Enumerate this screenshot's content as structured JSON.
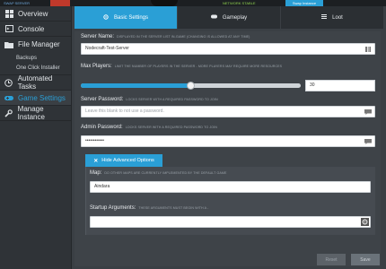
{
  "topbar": {
    "hint": "SWAP SERVER",
    "status": "NETWORK STABLE",
    "swap_button": "Swap Instance"
  },
  "sidebar": {
    "items": [
      {
        "label": "Overview",
        "icon": "dashboard-icon"
      },
      {
        "label": "Console",
        "icon": "console-icon"
      },
      {
        "label": "File Manager",
        "icon": "folder-icon"
      },
      {
        "label": "Automated Tasks",
        "icon": "clock-icon"
      },
      {
        "label": "Game Settings",
        "icon": "gamepad-icon"
      },
      {
        "label": "Manage Instance",
        "icon": "wrench-icon"
      }
    ],
    "sub_items": [
      "Backups",
      "One Click Installer"
    ]
  },
  "tabs": [
    {
      "label": "Basic Settings",
      "icon": "gear-icon"
    },
    {
      "label": "Gameplay",
      "icon": "gamepad-icon"
    },
    {
      "label": "Loot",
      "icon": "list-icon"
    }
  ],
  "fields": {
    "server_name": {
      "label": "Server Name:",
      "hint": "DISPLAYED IN THE SERVER LIST IN-GAME (CHANGING IS ALLOWED AT ANY TIME)",
      "value": "Nodecraft-Test-Server"
    },
    "max_players": {
      "label": "Max Players:",
      "hint": "LIMIT THE NUMBER OF PLAYERS IN THE SERVER - MORE PLAYERS MAY REQUIRE MORE RESOURCES",
      "value": "30",
      "slider_fraction": 0.5
    },
    "server_password": {
      "label": "Server Password:",
      "hint": "LOCKS SERVER WITH A REQUIRED PASSWORD TO JOIN",
      "placeholder": "Leave this blank to not use a password."
    },
    "admin_password": {
      "label": "Admin Password:",
      "hint": "LOCKS SERVER WITH A REQUIRED PASSWORD TO JOIN",
      "value": "••••••••••••"
    }
  },
  "advanced": {
    "toggle_label": "Hide Advanced Options",
    "map": {
      "label": "Map:",
      "hint": "DO OTHER MAPS ARE CURRENTLY IMPLEMENTED BY THE DEFAULT GAME",
      "value": "Aindara"
    },
    "startup_args": {
      "label": "Startup Arguments:",
      "hint": "THESE ARGUMENTS MUST BEGIN WITH A -",
      "value": ""
    }
  },
  "footer": {
    "reset_label": "Reset",
    "save_label": "Save"
  },
  "colors": {
    "accent": "#2a9fd6",
    "sidebar_bg": "#2f3337",
    "panel_bg": "#3e4348"
  }
}
